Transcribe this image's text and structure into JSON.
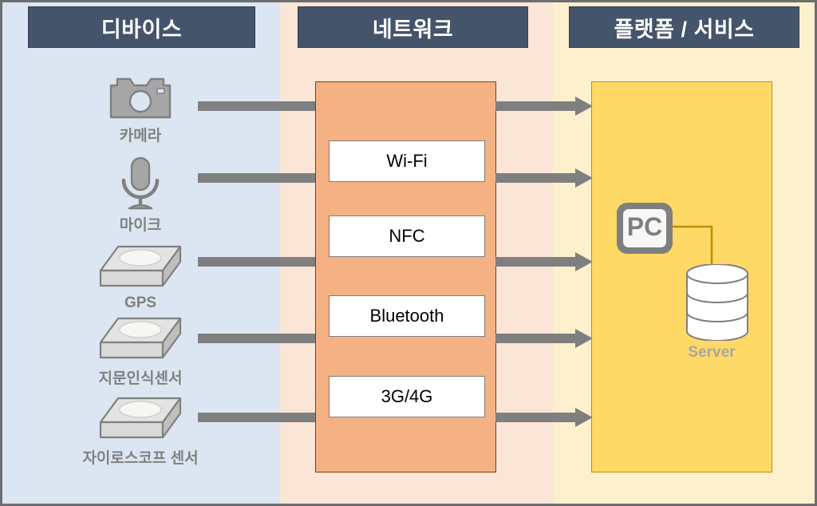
{
  "columns": [
    {
      "id": "devices",
      "header": "디바이스",
      "bg": "#dce6f2"
    },
    {
      "id": "network",
      "header": "네트워크",
      "bg": "#fbe5d6"
    },
    {
      "id": "platform",
      "header": "플랫폼 / 서비스",
      "bg": "#fdf0cd"
    }
  ],
  "devices": {
    "items": [
      {
        "label": "카메라",
        "icon": "camera-icon"
      },
      {
        "label": "마이크",
        "icon": "microphone-icon"
      },
      {
        "label": "GPS",
        "icon": "gps-sensor-icon"
      },
      {
        "label": "지문인식센서",
        "icon": "fingerprint-sensor-icon"
      },
      {
        "label": "자이로스코프 센서",
        "icon": "gyroscope-sensor-icon"
      }
    ]
  },
  "network": {
    "protocols": [
      {
        "label": "Wi-Fi"
      },
      {
        "label": "NFC"
      },
      {
        "label": "Bluetooth"
      },
      {
        "label": "3G/4G"
      }
    ]
  },
  "platform": {
    "pc_label": "PC",
    "server_label": "Server"
  },
  "colors": {
    "header_fill": "#44546a",
    "header_text": "#ffffff",
    "device_column": "#dce6f2",
    "network_column": "#fbe5d6",
    "platform_column": "#fdf0cd",
    "network_panel": "#f4b183",
    "platform_panel": "#ffd966",
    "arrow": "#7f7f7f",
    "device_icon": "#a6a6a6",
    "device_label": "#808080"
  },
  "arrows": {
    "left_connectors": 5,
    "right_connectors": 5
  }
}
